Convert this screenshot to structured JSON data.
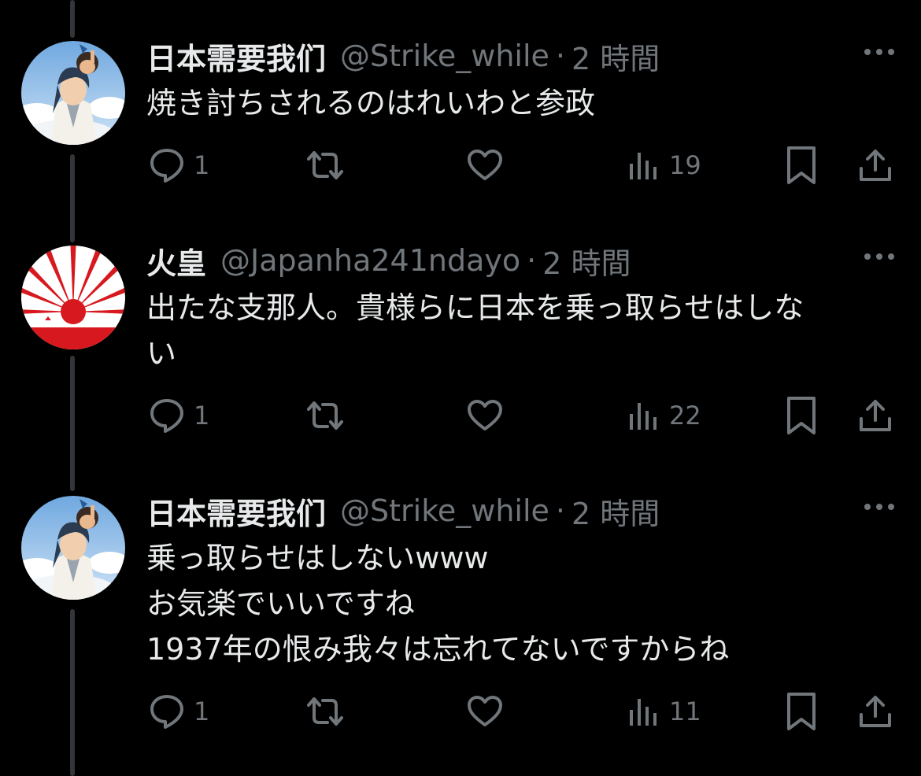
{
  "tweets": [
    {
      "name": "日本需要我们",
      "handle": "@Strike_while",
      "separator": "·",
      "time": "2 時間",
      "lines": [
        "焼き討ちされるのはれいわと参政"
      ],
      "replies": "1",
      "views": "19",
      "avatar": "anime-avatar"
    },
    {
      "name": "火皇",
      "handle": "@Japanha241ndayo",
      "separator": "·",
      "time": "2 時間",
      "lines": [
        "出たな支那人。貴様らに日本を乗っ取らせはしな",
        "い"
      ],
      "replies": "1",
      "views": "22",
      "avatar": "rising-sun-avatar"
    },
    {
      "name": "日本需要我们",
      "handle": "@Strike_while",
      "separator": "·",
      "time": "2 時間",
      "lines": [
        "乗っ取らせはしないwww",
        "お気楽でいいですね",
        "1937年の恨み我々は忘れてないですからね"
      ],
      "replies": "1",
      "views": "11",
      "avatar": "anime-avatar"
    }
  ],
  "colors": {
    "background": "#000000",
    "text_primary": "#e7e9ea",
    "text_secondary": "#71767b",
    "thread_line": "#333639",
    "sun_red": "#d7191f"
  }
}
